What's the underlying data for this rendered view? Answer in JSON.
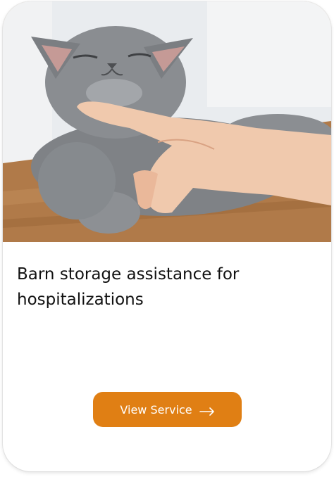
{
  "card": {
    "image_alt": "Gray cat being scratched under the chin",
    "title": "Barn storage assistance for hospitalizations",
    "button_label": "View Service",
    "button_icon": "arrow-right-icon"
  },
  "colors": {
    "accent": "#e07f14",
    "title_text": "#111111",
    "card_background": "#ffffff"
  }
}
